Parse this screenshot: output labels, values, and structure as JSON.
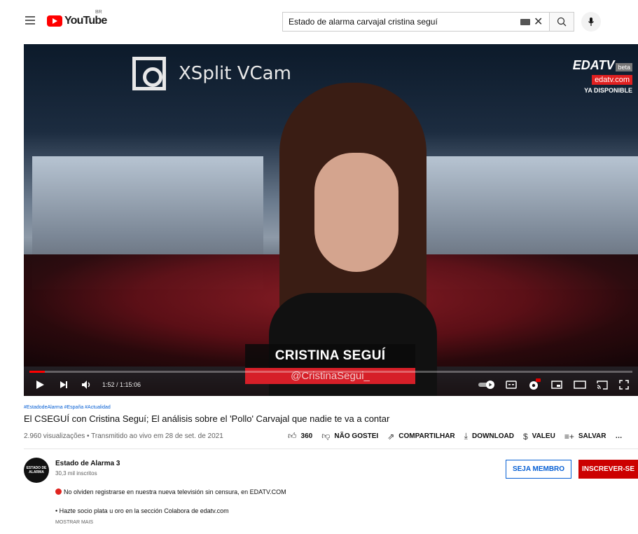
{
  "header": {
    "logo_text": "YouTube",
    "region": "BR",
    "search_value": "Estado de alarma carvajal cristina seguí"
  },
  "video": {
    "overlay_xsplit": "XSplit VCam",
    "overlay_edatv": "EDATV",
    "overlay_beta": "beta",
    "overlay_url": "edatv.com",
    "overlay_available": "YA DISPONIBLE",
    "lower_third_name": "CRISTINA SEGUÍ",
    "lower_third_handle": "@CristinaSegui_",
    "time": "1:52 / 1:15:06",
    "progress": 0.025
  },
  "info": {
    "hashtags": "#EstadodeAlarma #España #Actualidad",
    "title": "El CSEGUÍ con Cristina Seguí; El análisis sobre el 'Pollo' Carvajal que nadie te va a contar",
    "meta": "2.960 visualizações • Transmitido ao vivo em 28 de set. de 2021"
  },
  "actions": {
    "likes": "360",
    "dislike": "NÃO GOSTEI",
    "share": "COMPARTILHAR",
    "download": "DOWNLOAD",
    "thanks": "VALEU",
    "save": "SALVAR",
    "more": "…"
  },
  "channel": {
    "avatar_text": "ESTADO DE ALARMA",
    "name": "Estado de Alarma 3",
    "subscribers": "30,3 mil inscritos",
    "member_button": "SEJA MEMBRO",
    "subscribe_button": "INSCREVER-SE"
  },
  "description": {
    "line1": "No olviden registrarse en nuestra nueva televisión sin censura, en EDATV.COM",
    "line2": "• Hazte socio plata u oro en la sección Colabora de edatv.com",
    "show_more": "MOSTRAR MAIS"
  },
  "colors": {
    "brand_red": "#ff0000",
    "subscribe_red": "#cc0000",
    "link_blue": "#065fd4"
  }
}
